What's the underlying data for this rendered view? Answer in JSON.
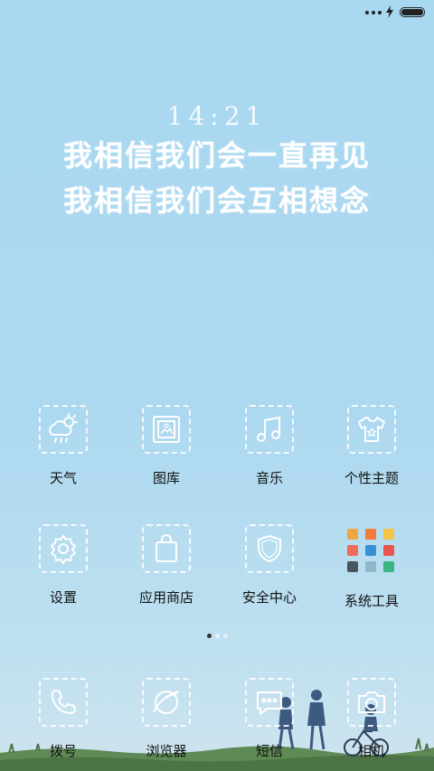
{
  "clock": "14:21",
  "quote_lines": [
    "我相信我们会一直再见",
    "我相信我们会互相想念"
  ],
  "colors": {
    "background": "#add9f0",
    "label": "#111111",
    "icon_line": "#ffffff"
  },
  "rows": [
    {
      "apps": [
        {
          "label": "天气",
          "icon": "weather-icon"
        },
        {
          "label": "图库",
          "icon": "gallery-icon"
        },
        {
          "label": "音乐",
          "icon": "music-icon"
        },
        {
          "label": "个性主题",
          "icon": "theme-shirt-icon"
        }
      ]
    },
    {
      "apps": [
        {
          "label": "设置",
          "icon": "gear-icon"
        },
        {
          "label": "应用商店",
          "icon": "shopping-bag-icon"
        },
        {
          "label": "安全中心",
          "icon": "shield-icon"
        },
        {
          "label": "系统工具",
          "icon": "folder-icon"
        }
      ]
    }
  ],
  "pager": {
    "pages": 3,
    "current": 1
  },
  "dock": [
    {
      "label": "拨号",
      "icon": "phone-icon"
    },
    {
      "label": "浏览器",
      "icon": "browser-icon"
    },
    {
      "label": "短信",
      "icon": "message-icon"
    },
    {
      "label": "相机",
      "icon": "camera-icon"
    }
  ]
}
